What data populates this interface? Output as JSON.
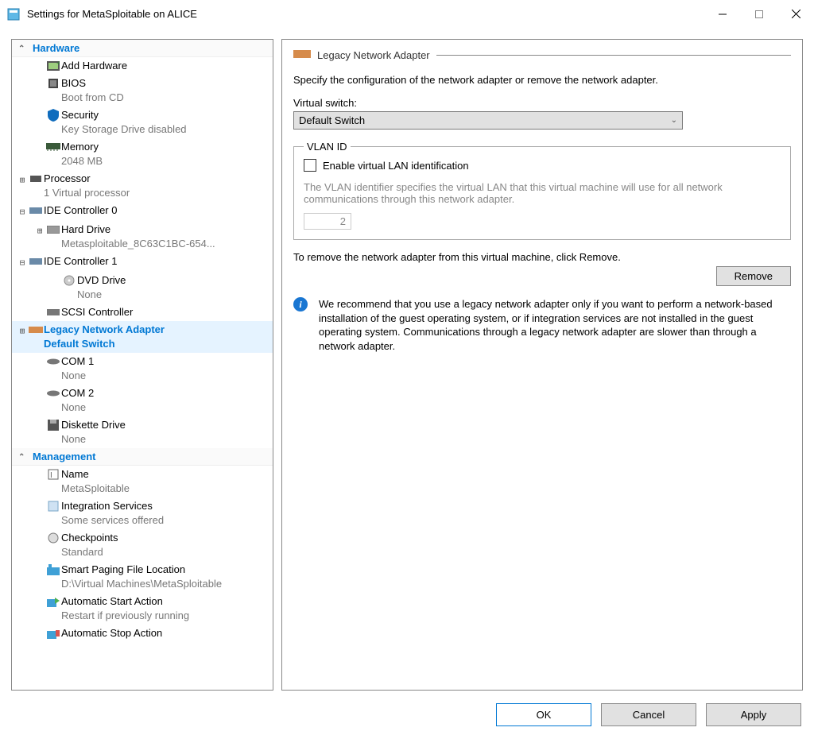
{
  "window": {
    "title": "Settings for MetaSploitable on ALICE"
  },
  "sidebar": {
    "hardware_header": "Hardware",
    "management_header": "Management",
    "add_hardware": "Add Hardware",
    "bios": {
      "label": "BIOS",
      "sub": "Boot from CD"
    },
    "security": {
      "label": "Security",
      "sub": "Key Storage Drive disabled"
    },
    "memory": {
      "label": "Memory",
      "sub": "2048 MB"
    },
    "processor": {
      "label": "Processor",
      "sub": "1 Virtual processor"
    },
    "ide0": {
      "label": "IDE Controller 0"
    },
    "harddrive": {
      "label": "Hard Drive",
      "sub": "Metasploitable_8C63C1BC-654..."
    },
    "ide1": {
      "label": "IDE Controller 1"
    },
    "dvd": {
      "label": "DVD Drive",
      "sub": "None"
    },
    "scsi": {
      "label": "SCSI Controller"
    },
    "netadapter": {
      "label": "Legacy Network Adapter",
      "sub": "Default Switch"
    },
    "com1": {
      "label": "COM 1",
      "sub": "None"
    },
    "com2": {
      "label": "COM 2",
      "sub": "None"
    },
    "diskette": {
      "label": "Diskette Drive",
      "sub": "None"
    },
    "name": {
      "label": "Name",
      "sub": "MetaSploitable"
    },
    "integ": {
      "label": "Integration Services",
      "sub": "Some services offered"
    },
    "check": {
      "label": "Checkpoints",
      "sub": "Standard"
    },
    "smart": {
      "label": "Smart Paging File Location",
      "sub": "D:\\Virtual Machines\\MetaSploitable"
    },
    "autostart": {
      "label": "Automatic Start Action",
      "sub": "Restart if previously running"
    },
    "autostop": {
      "label": "Automatic Stop Action"
    }
  },
  "content": {
    "title": "Legacy Network Adapter",
    "desc": "Specify the configuration of the network adapter or remove the network adapter.",
    "vswitch_label": "Virtual switch:",
    "vswitch_value": "Default Switch",
    "vlan_legend": "VLAN ID",
    "vlan_enable": "Enable virtual LAN identification",
    "vlan_help": "The VLAN identifier specifies the virtual LAN that this virtual machine will use for all network communications through this network adapter.",
    "vlan_value": "2",
    "remove_text": "To remove the network adapter from this virtual machine, click Remove.",
    "remove_btn": "Remove",
    "info": "We recommend that you use a legacy network adapter only if you want to perform a network-based installation of the guest operating system, or if integration services are not installed in the guest operating system. Communications through a legacy network adapter are slower than through a network adapter."
  },
  "footer": {
    "ok": "OK",
    "cancel": "Cancel",
    "apply": "Apply"
  }
}
